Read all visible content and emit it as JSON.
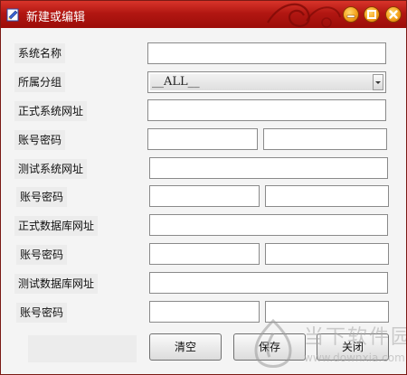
{
  "window": {
    "title": "新建或编辑",
    "controls": {
      "minimize_icon": "minimize-icon",
      "maximize_icon": "maximize-icon",
      "close_icon": "close-icon"
    },
    "colors": {
      "titlebar": "#b21712",
      "control_buttons": "#f4a21b"
    }
  },
  "form": {
    "system_name": {
      "label": "系统名称",
      "value": ""
    },
    "group": {
      "label": "所属分组",
      "selected": "__ALL__"
    },
    "prod_system_url": {
      "label": "正式系统网址",
      "value": ""
    },
    "prod_system_account": {
      "label": "账号密码",
      "account": "",
      "password": ""
    },
    "test_system_url": {
      "label": "测试系统网址",
      "value": ""
    },
    "test_system_account": {
      "label": "账号密码",
      "account": "",
      "password": ""
    },
    "prod_db_url": {
      "label": "正式数据库网址",
      "value": ""
    },
    "prod_db_account": {
      "label": "账号密码",
      "account": "",
      "password": ""
    },
    "test_db_url": {
      "label": "测试数据库网址",
      "value": ""
    },
    "test_db_account": {
      "label": "账号密码",
      "account": "",
      "password": ""
    }
  },
  "buttons": {
    "clear": "清空",
    "save": "保存",
    "close": "关闭"
  },
  "watermark": {
    "text": "当下软件园",
    "url": "www.downxia.com"
  }
}
